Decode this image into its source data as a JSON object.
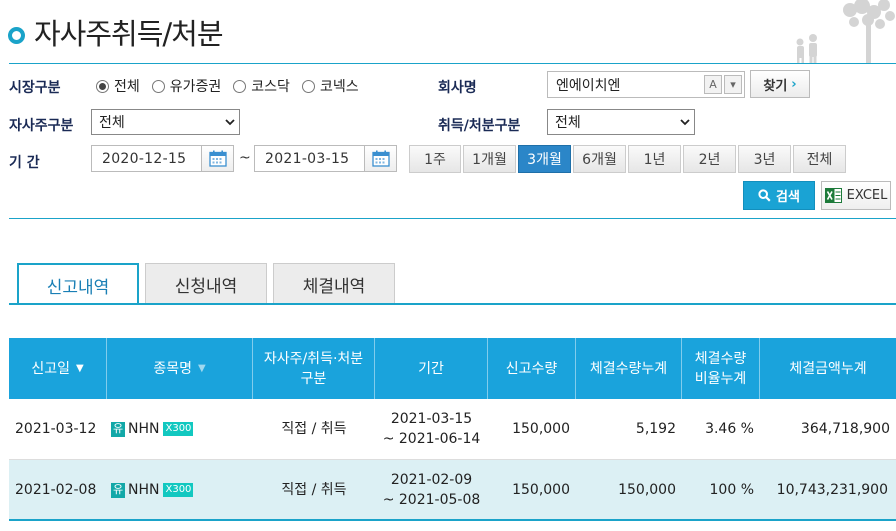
{
  "page": {
    "title": "자사주취득/처분"
  },
  "filters": {
    "market_label": "시장구분",
    "market_options": [
      {
        "label": "전체",
        "selected": true
      },
      {
        "label": "유가증권",
        "selected": false
      },
      {
        "label": "코스닥",
        "selected": false
      },
      {
        "label": "코넥스",
        "selected": false
      }
    ],
    "company_label": "회사명",
    "company_value": "엔에이치엔",
    "company_mini_a": "A",
    "company_mini_down": "▾",
    "find_label": "찾기",
    "treasury_label": "자사주구분",
    "treasury_value": "전체",
    "acq_label": "취득/처분구분",
    "acq_value": "전체",
    "period_label": "기 간",
    "date_from": "2020-12-15",
    "date_to": "2021-03-15",
    "tilde": "~",
    "period_buttons": [
      {
        "label": "1주",
        "active": false
      },
      {
        "label": "1개월",
        "active": false
      },
      {
        "label": "3개월",
        "active": true
      },
      {
        "label": "6개월",
        "active": false
      },
      {
        "label": "1년",
        "active": false
      },
      {
        "label": "2년",
        "active": false
      },
      {
        "label": "3년",
        "active": false
      },
      {
        "label": "전체",
        "active": false
      }
    ],
    "search_label": "검색",
    "excel_label": "EXCEL"
  },
  "tabs": [
    {
      "label": "신고내역",
      "active": true
    },
    {
      "label": "신청내역",
      "active": false
    },
    {
      "label": "체결내역",
      "active": false
    }
  ],
  "table": {
    "headers": [
      {
        "label": "신고일",
        "sort": "▼"
      },
      {
        "label": "종목명",
        "sort": "▼"
      },
      {
        "label": "자사주/취득·처분\n구분",
        "sort": ""
      },
      {
        "label": "기간",
        "sort": ""
      },
      {
        "label": "신고수량",
        "sort": ""
      },
      {
        "label": "체결수량누계",
        "sort": ""
      },
      {
        "label": "체결수량\n비율누계",
        "sort": ""
      },
      {
        "label": "체결금액누계",
        "sort": ""
      }
    ],
    "rows": [
      {
        "date": "2021-03-12",
        "market_badge": "유",
        "name": "NHN",
        "index_badge": "X300",
        "type": "직접 / 취득",
        "period_start": "2021-03-15",
        "period_end": "~ 2021-06-14",
        "reported_qty": "150,000",
        "executed_qty": "5,192",
        "executed_ratio": "3.46 %",
        "executed_amount": "364,718,900"
      },
      {
        "date": "2021-02-08",
        "market_badge": "유",
        "name": "NHN",
        "index_badge": "X300",
        "type": "직접 / 취득",
        "period_start": "2021-02-09",
        "period_end": "~ 2021-05-08",
        "reported_qty": "150,000",
        "executed_qty": "150,000",
        "executed_ratio": "100 %",
        "executed_amount": "10,743,231,900"
      }
    ]
  },
  "colors": {
    "accent": "#1aa3c9",
    "header_bg": "#1aa3dc",
    "active_period": "#2b86c8",
    "alt_row": "#dcf0f4"
  }
}
